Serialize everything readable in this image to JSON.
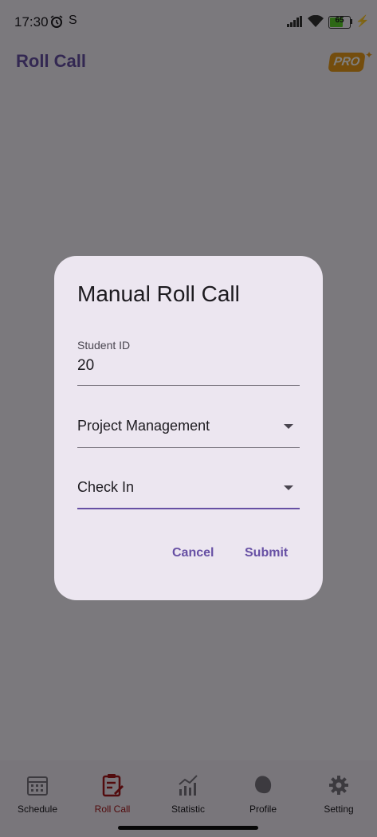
{
  "status_bar": {
    "time": "17:30",
    "s_icon": "S",
    "battery": "65",
    "bolt": "⚡"
  },
  "app_bar": {
    "title": "Roll Call",
    "pro_badge": "PRO",
    "sparkle": "✦"
  },
  "dialog": {
    "title": "Manual Roll Call",
    "student_id_label": "Student ID",
    "student_id_value": "20",
    "course": "Project Management",
    "action": "Check In",
    "cancel_label": "Cancel",
    "submit_label": "Submit"
  },
  "bottom_nav": [
    {
      "label": "Schedule",
      "icon": "calendar-icon",
      "active": false
    },
    {
      "label": "Roll Call",
      "icon": "clipboard-edit-icon",
      "active": true
    },
    {
      "label": "Statistic",
      "icon": "chart-icon",
      "active": false
    },
    {
      "label": "Profile",
      "icon": "profile-icon",
      "active": false
    },
    {
      "label": "Setting",
      "icon": "gear-icon",
      "active": false
    }
  ],
  "colors": {
    "accent": "#6750a4",
    "active_nav": "#a4161a",
    "pro": "#e89a1a"
  }
}
